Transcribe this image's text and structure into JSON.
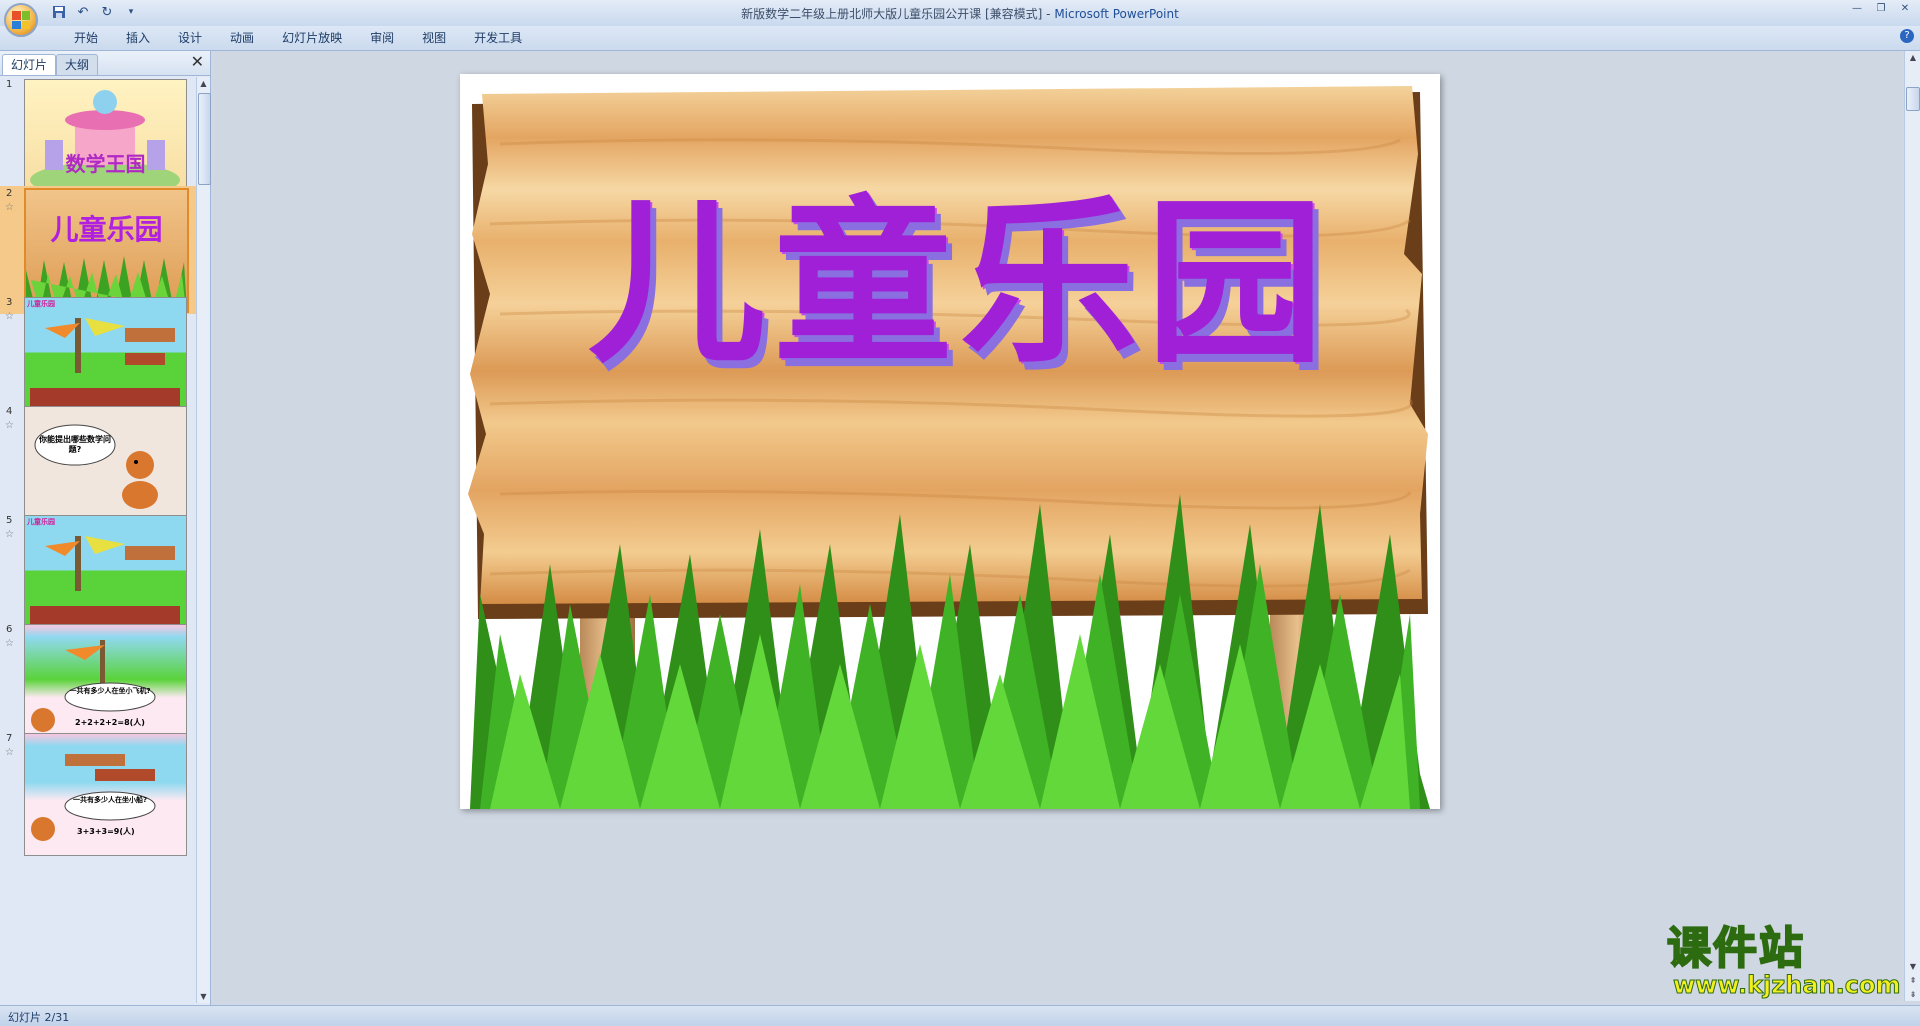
{
  "window": {
    "title_doc": "新版数学二年级上册北师大版儿童乐园公开课 [兼容模式]",
    "title_sep": " - ",
    "title_app": "Microsoft PowerPoint"
  },
  "qat": {
    "save_icon": "save-icon",
    "undo_icon": "undo-icon",
    "redo_icon": "redo-icon",
    "customize_icon": "dropdown-icon"
  },
  "menu": {
    "items": [
      "开始",
      "插入",
      "设计",
      "动画",
      "幻灯片放映",
      "审阅",
      "视图",
      "开发工具"
    ]
  },
  "left_pane": {
    "tab_slides": "幻灯片",
    "tab_outline": "大纲",
    "thumbnails": [
      {
        "num": "1",
        "caption": "数学王国"
      },
      {
        "num": "2",
        "caption": "儿童乐园"
      },
      {
        "num": "3",
        "caption": "儿童乐园"
      },
      {
        "num": "4",
        "caption": "你能提出哪些数学问题?"
      },
      {
        "num": "5",
        "caption": "儿童乐园"
      },
      {
        "num": "6",
        "caption": "一共有多少人在坐小飞机?",
        "equation": "2+2+2+2=8(人)"
      },
      {
        "num": "7",
        "caption": "一共有多少人在坐小船?",
        "equation": "3+3+3=9(人)"
      }
    ]
  },
  "slide": {
    "title": "儿童乐园"
  },
  "status": {
    "slide_indicator": "幻灯片 2/31"
  },
  "watermark": {
    "title": "课件站",
    "url": "www.kjzhan.com"
  },
  "colors": {
    "title_purple": "#a020d8",
    "wood": "#e8b776",
    "grass": "#2f9d1c",
    "selected_thumb": "#f5c98a"
  }
}
